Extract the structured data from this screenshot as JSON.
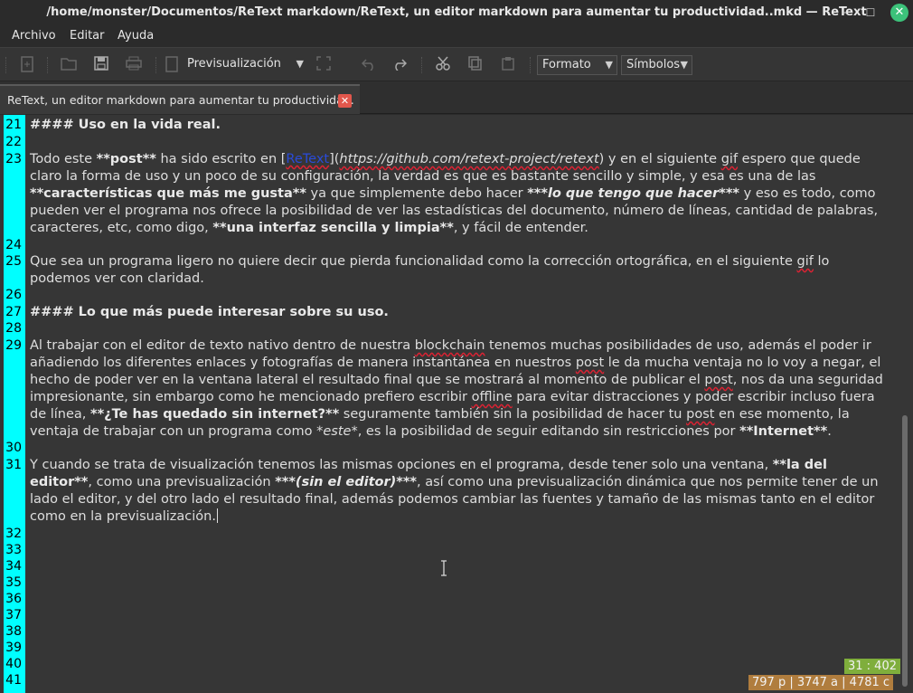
{
  "window": {
    "title": "/home/monster/Documentos/ReText markdown/ReText, un editor markdown para aumentar tu productividad..mkd — ReText",
    "minimize_glyph": "–",
    "maximize_glyph": "☐",
    "close_glyph": "✕"
  },
  "menu": {
    "items": [
      "Archivo",
      "Editar",
      "Ayuda"
    ]
  },
  "toolbar": {
    "preview_label": "Previsualización",
    "format_label": "Formato",
    "symbols_label": "Símbolos",
    "icons": [
      "new-icon",
      "open-icon",
      "save-icon",
      "print-icon",
      "preview-icon",
      "fullscreen-icon",
      "undo-icon",
      "redo-icon",
      "cut-icon",
      "copy-icon",
      "paste-icon"
    ]
  },
  "tab": {
    "label": "ReText, un editor markdown para aumentar tu productividad.",
    "close_glyph": "✕"
  },
  "editor": {
    "line_numbers": [
      "21",
      "22",
      "23",
      "24",
      "25",
      "26",
      "27",
      "28",
      "29",
      "30",
      "31",
      "32",
      "33",
      "34",
      "35",
      "36",
      "37",
      "38",
      "39",
      "40",
      "41"
    ],
    "h_uso": "#### Uso en la vida real.",
    "p23": {
      "a": "Todo este ",
      "b": "**post**",
      "c": " ha sido escrito en [",
      "link": "ReText",
      "d": "](",
      "url": "https://github.com/retext-project/retext",
      "e": ") y en el siguiente ",
      "gif": "gif",
      "f": " espero que quede",
      "l2": "claro la forma de uso y un poco de su configuración, la verdad es que es bastante sencillo y simple, y esa es una de las",
      "l3_b1": "**características que más me gusta**",
      "l3_t1": " ya que simplemente debo hacer ",
      "l3_bi": "***lo que tengo que hacer***",
      "l3_t2": " y eso es todo, como",
      "l4": "pueden ver el programa nos ofrece la posibilidad de ver las estadísticas del documento, número de líneas, cantidad de palabras,",
      "l5_t1": "caracteres, etc, como digo, ",
      "l5_b1": "**una interfaz sencilla y limpia**",
      "l5_t2": ", y fácil de entender."
    },
    "p25": {
      "a": "Que sea un programa ligero no quiere decir que pierda funcionalidad como la corrección ortográfica, en el  siguiente ",
      "gif": "gif",
      "b": " lo",
      "l2": "podemos ver con claridad."
    },
    "h_interes": "#### Lo que más puede interesar sobre su uso.",
    "p29": {
      "l1a": "Al trabajar con el editor de texto nativo dentro de nuestra ",
      "blockchain": "blockchain",
      "l1b": " tenemos muchas posibilidades de uso, además el poder ir",
      "l2a": "añadiendo los diferentes enlaces y fotografías de manera instantánea en nuestros ",
      "post1": "post",
      "l2b": " le da mucha ventaja no lo voy a negar, el",
      "l3a": "hecho de poder ver en la ventana lateral el resultado final que se mostrará al momento de publicar el ",
      "post2": "post",
      "l3b": ", nos da una seguridad",
      "l4a": "impresionante, sin embargo como he mencionado prefiero escribir ",
      "offline": "offline",
      "l4b": " para evitar distracciones y poder escribir incluso fuera",
      "l5a": "de línea, ",
      "l5b": "**¿Te has quedado sin internet?**",
      "l5c": " seguramente también sin la posibilidad de hacer tu ",
      "post3": "post",
      "l5d": " en ese momento, la",
      "l6a": "ventaja de trabajar con un programa como ",
      "l6i": "*este*",
      "l6b": ", es la posibilidad de seguir editando sin restricciones por ",
      "l6c": "**Internet**",
      "l6d": "."
    },
    "p31": {
      "l1a": "Y cuando se trata de visualización tenemos las mismas opciones en el programa, desde tener solo una ventana, ",
      "l1b": "**la del",
      "l2a": "editor**",
      "l2b": ", como una previsualización  ",
      "l2c": "***(sin el editor)***",
      "l2d": ", así como una previsualización dinámica que nos permite tener de un",
      "l3": "lado el editor, y del otro lado el resultado final, además podemos cambiar las fuentes y tamaño de las mismas tanto en el editor",
      "l4": "como en la previsualización."
    }
  },
  "status": {
    "position": "31 : 402",
    "stats": "797 p | 3747 a | 4781 c"
  }
}
